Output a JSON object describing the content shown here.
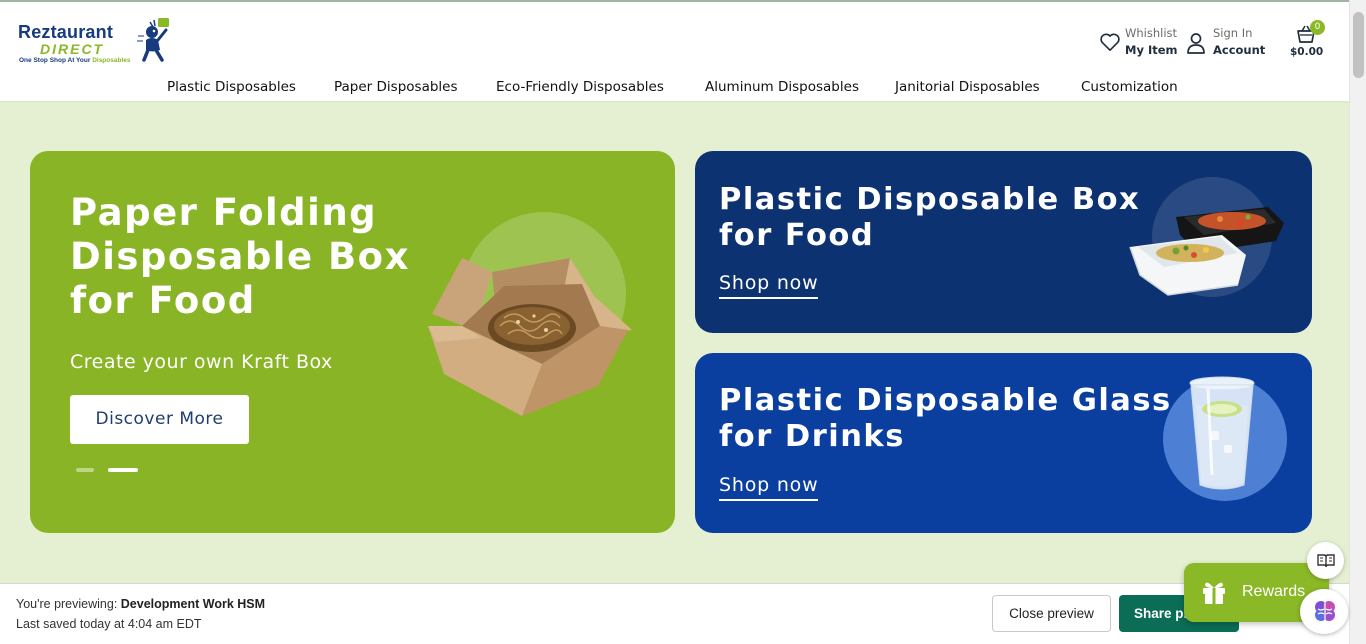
{
  "header": {
    "logo": {
      "brand_line1": "Reztaurant",
      "brand_line2": "DIRECT",
      "tagline_pre": "One Stop Shop At Your ",
      "tagline_hl": "Disposables"
    },
    "wishlist": {
      "line1": "Whishlist",
      "line2": "My Item",
      "icon": "heart-icon"
    },
    "account": {
      "line1": "Sign In",
      "line2": "Account",
      "icon": "user-icon"
    },
    "cart": {
      "count": "0",
      "total": "$0.00",
      "icon": "basket-icon"
    }
  },
  "nav": [
    {
      "label": "Plastic Disposables"
    },
    {
      "label": "Paper Disposables"
    },
    {
      "label": "Eco-Friendly Disposables"
    },
    {
      "label": "Aluminum Disposables"
    },
    {
      "label": "Janitorial Disposables"
    },
    {
      "label": "Customization"
    }
  ],
  "hero": {
    "main": {
      "title": "Paper Folding Disposable Box for Food",
      "subtitle": "Create your own Kraft Box",
      "button": "Discover More",
      "slides_total": 2,
      "active_slide": 2
    },
    "cards": [
      {
        "title_line1": "Plastic Disposable Box",
        "title_line2": "for Food",
        "link": "Shop now"
      },
      {
        "title_line1": "Plastic Disposable Glass",
        "title_line2": "for Drinks",
        "link": "Shop now"
      }
    ]
  },
  "preview_bar": {
    "prefix": "You're previewing: ",
    "theme_name": "Development Work HSM",
    "saved": "Last saved today at 4:04 am EDT",
    "close_button": "Close preview",
    "share_button": "Share preview"
  },
  "rewards": {
    "label": "Rewards",
    "icon": "gift-icon"
  },
  "colors": {
    "brand_green": "#88b425",
    "brand_navy": "#0d3272",
    "brand_blue": "#0b3f9f",
    "page_bg": "#e5f0d2",
    "share_green": "#0b6d56"
  }
}
